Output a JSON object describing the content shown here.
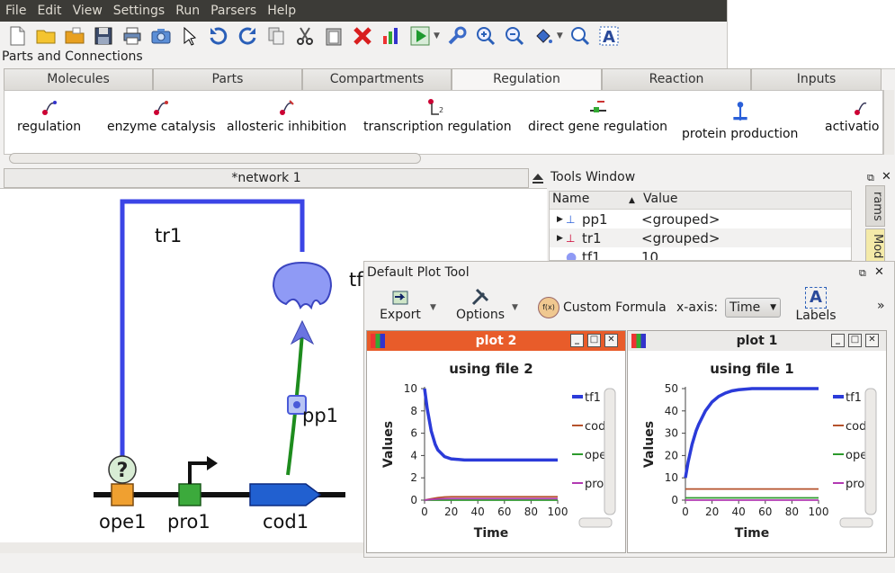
{
  "menu": [
    "File",
    "Edit",
    "View",
    "Settings",
    "Run",
    "Parsers",
    "Help"
  ],
  "parts_label": "Parts and Connections",
  "tabs": [
    "Molecules",
    "Parts",
    "Compartments",
    "Regulation",
    "Reaction",
    "Inputs"
  ],
  "palette": [
    "regulation",
    "enzyme catalysis",
    "allosteric inhibition",
    "transcription regulation",
    "direct gene regulation",
    "protein production",
    "activatio"
  ],
  "network_tab": "*network 1",
  "network": {
    "labels": {
      "tr1": "tr1",
      "tf_partial": "tf",
      "pp1": "pp1",
      "ope1": "ope1",
      "pro1": "pro1",
      "cod1": "cod1"
    }
  },
  "tools": {
    "title": "Tools Window",
    "col_name": "Name",
    "col_value": "Value",
    "rows": [
      {
        "name": "pp1",
        "value": "<grouped>"
      },
      {
        "name": "tr1",
        "value": "<grouped>"
      },
      {
        "name": "tf1",
        "value": "10"
      }
    ],
    "side_tabs": [
      "rams",
      "Mod"
    ]
  },
  "plot_tool": {
    "title": "Default Plot Tool",
    "export": "Export",
    "options": "Options",
    "custom_formula": "Custom Formula",
    "fx": "f(x)",
    "xaxis_label": "x-axis:",
    "xaxis_value": "Time",
    "labels_btn": "Labels",
    "labels_icon": "A",
    "more": "»"
  },
  "plots": [
    {
      "window_title": "plot 2",
      "chart_title": "using file 2",
      "ylabel": "Values",
      "xlabel": "Time",
      "legend": [
        "tf1",
        "cod",
        "ope",
        "pro"
      ]
    },
    {
      "window_title": "plot 1",
      "chart_title": "using file 1",
      "ylabel": "Values",
      "xlabel": "Time",
      "legend": [
        "tf1",
        "cod",
        "ope",
        "pro"
      ]
    }
  ],
  "chart_data": [
    {
      "type": "line",
      "title": "using file 2",
      "xlabel": "Time",
      "ylabel": "Values",
      "xlim": [
        0,
        100
      ],
      "ylim": [
        0,
        10
      ],
      "xticks": [
        0,
        20,
        40,
        60,
        80,
        100
      ],
      "yticks": [
        0,
        2,
        4,
        6,
        8,
        10
      ],
      "x": [
        0,
        2,
        5,
        8,
        10,
        15,
        20,
        30,
        40,
        50,
        60,
        70,
        80,
        90,
        100
      ],
      "series": [
        {
          "name": "tf1",
          "color": "#2b3bd9",
          "values": [
            10,
            8.2,
            6.2,
            5.0,
            4.5,
            3.9,
            3.7,
            3.6,
            3.6,
            3.6,
            3.6,
            3.6,
            3.6,
            3.6,
            3.6
          ]
        },
        {
          "name": "cod",
          "color": "#b5522c",
          "values": [
            0,
            0.05,
            0.12,
            0.18,
            0.22,
            0.28,
            0.3,
            0.3,
            0.3,
            0.3,
            0.3,
            0.3,
            0.3,
            0.3,
            0.3
          ]
        },
        {
          "name": "ope",
          "color": "#2c9a2c",
          "values": [
            0,
            0,
            0,
            0,
            0,
            0,
            0,
            0,
            0,
            0,
            0,
            0,
            0,
            0,
            0
          ]
        },
        {
          "name": "pro",
          "color": "#b23ab2",
          "values": [
            0,
            0.03,
            0.06,
            0.08,
            0.1,
            0.12,
            0.13,
            0.13,
            0.13,
            0.13,
            0.13,
            0.13,
            0.13,
            0.13,
            0.13
          ]
        }
      ]
    },
    {
      "type": "line",
      "title": "using file 1",
      "xlabel": "Time",
      "ylabel": "Values",
      "xlim": [
        0,
        100
      ],
      "ylim": [
        0,
        50
      ],
      "xticks": [
        0,
        20,
        40,
        60,
        80,
        100
      ],
      "yticks": [
        0,
        10,
        20,
        30,
        40,
        50
      ],
      "x": [
        0,
        2,
        5,
        8,
        10,
        15,
        20,
        25,
        30,
        35,
        40,
        50,
        60,
        70,
        80,
        90,
        100
      ],
      "series": [
        {
          "name": "tf1",
          "color": "#2b3bd9",
          "values": [
            10,
            17,
            25,
            31,
            34,
            40,
            44,
            46.5,
            48,
            49,
            49.5,
            50,
            50,
            50,
            50,
            50,
            50
          ]
        },
        {
          "name": "cod",
          "color": "#b5522c",
          "values": [
            5,
            5,
            5,
            5,
            5,
            5,
            5,
            5,
            5,
            5,
            5,
            5,
            5,
            5,
            5,
            5,
            5
          ]
        },
        {
          "name": "ope",
          "color": "#2c9a2c",
          "values": [
            1,
            1,
            1,
            1,
            1,
            1,
            1,
            1,
            1,
            1,
            1,
            1,
            1,
            1,
            1,
            1,
            1
          ]
        },
        {
          "name": "pro",
          "color": "#b23ab2",
          "values": [
            0,
            0,
            0,
            0,
            0,
            0,
            0,
            0,
            0,
            0,
            0,
            0,
            0,
            0,
            0,
            0,
            0
          ]
        }
      ]
    }
  ]
}
